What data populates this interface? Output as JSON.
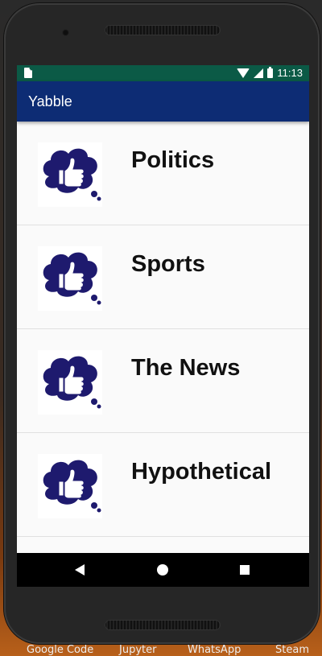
{
  "status_bar": {
    "time": "11:13"
  },
  "app_bar": {
    "title": "Yabble"
  },
  "topics": [
    {
      "label": "Politics",
      "icon": "thumbs-up-bubble-icon"
    },
    {
      "label": "Sports",
      "icon": "thumbs-up-bubble-icon"
    },
    {
      "label": "The News",
      "icon": "thumbs-up-bubble-icon"
    },
    {
      "label": "Hypothetical",
      "icon": "thumbs-up-bubble-icon"
    }
  ],
  "taskbar": {
    "items": [
      "Google Code",
      "Jupyter",
      "WhatsApp",
      "Steam"
    ]
  },
  "colors": {
    "status_bar": "#0b5a46",
    "app_bar": "#0d2c74",
    "icon_fill": "#1e1a6e"
  }
}
